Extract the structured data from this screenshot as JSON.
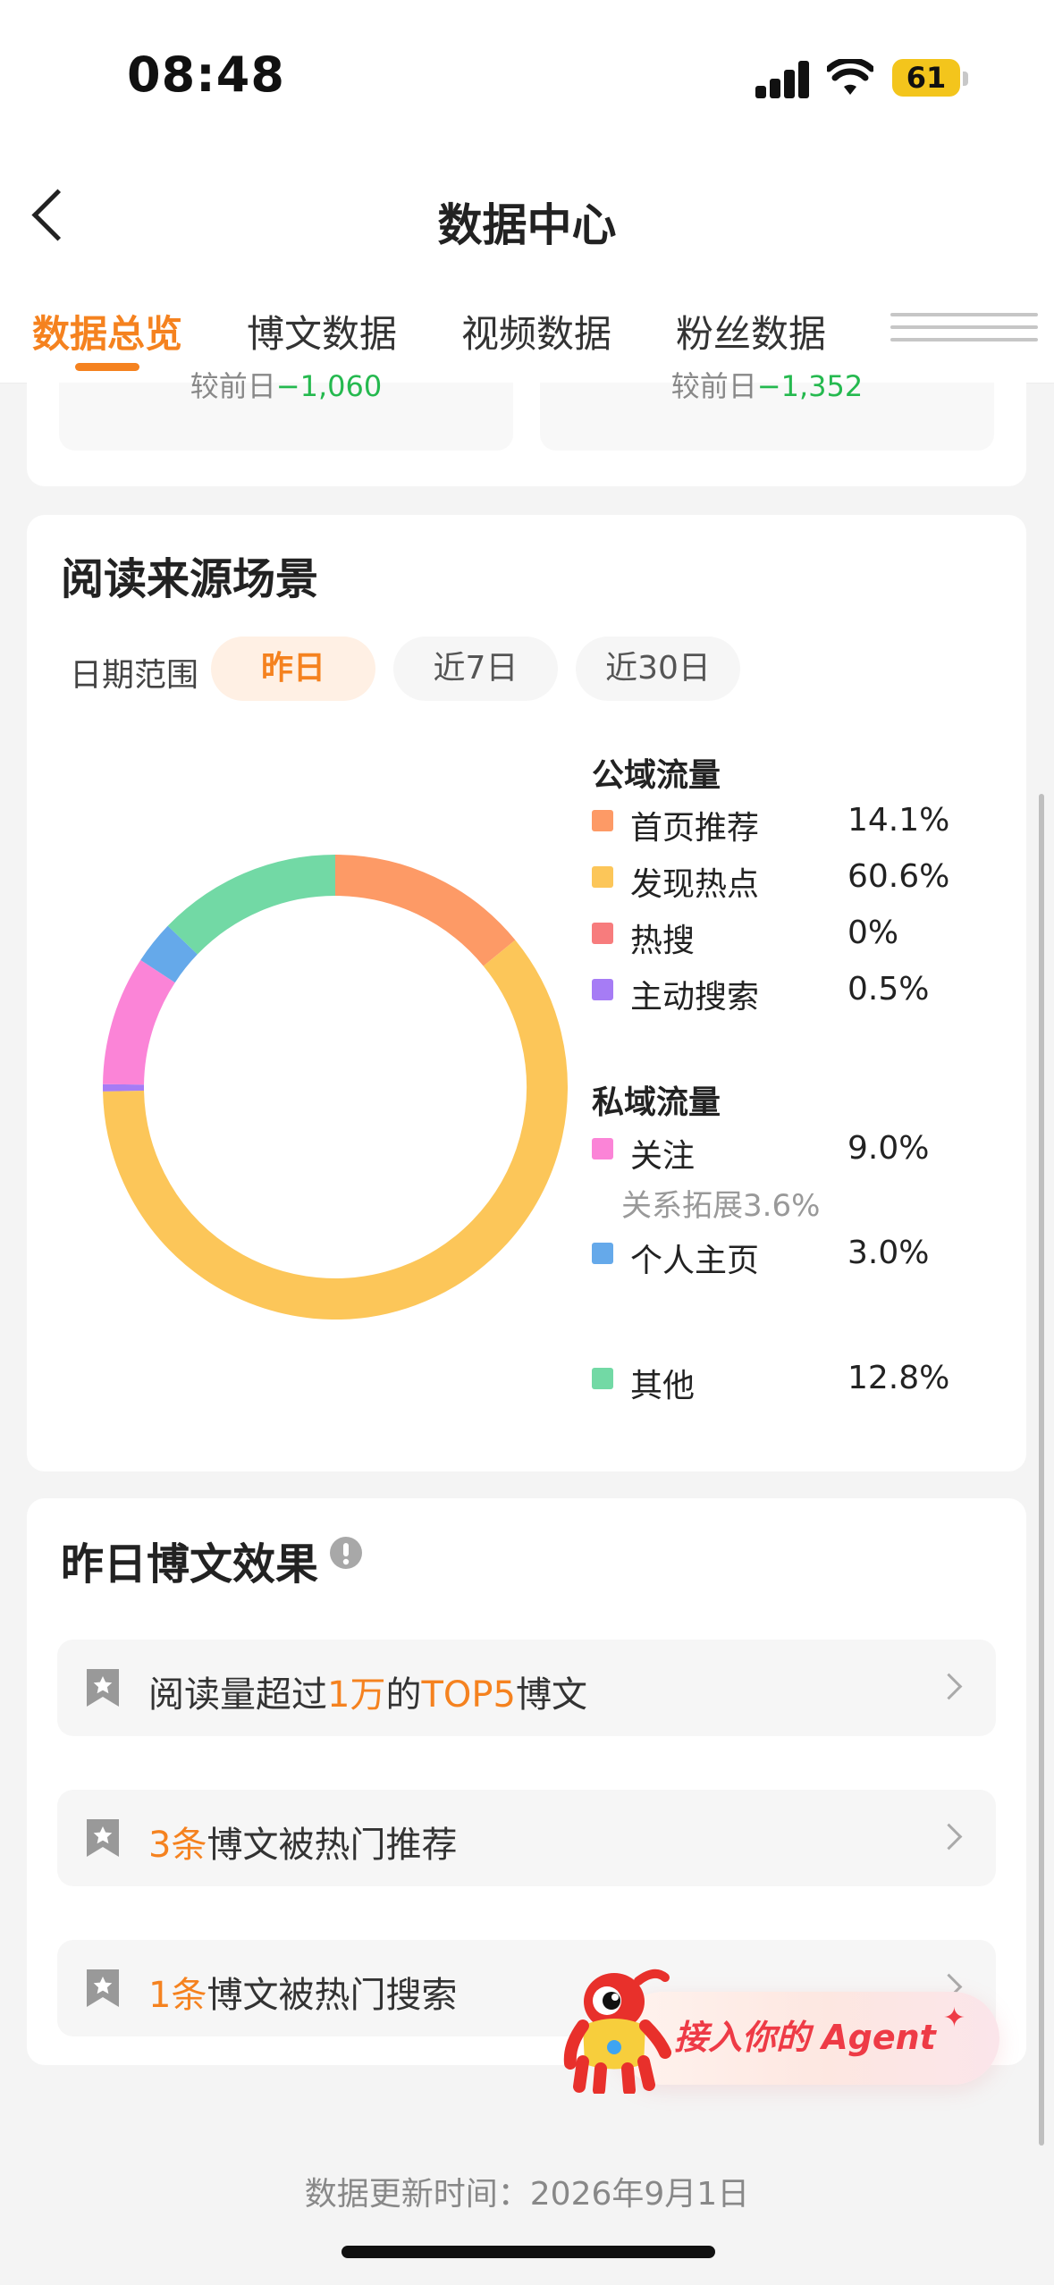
{
  "status_bar": {
    "time": "08:48",
    "battery": "61"
  },
  "header": {
    "title": "数据中心",
    "back_icon": "chevron-left-icon"
  },
  "tabs": [
    {
      "label": "数据总览",
      "active": true
    },
    {
      "label": "博文数据",
      "active": false
    },
    {
      "label": "视频数据",
      "active": false
    },
    {
      "label": "粉丝数据",
      "active": false
    }
  ],
  "top_compare": {
    "left": {
      "prefix": "较前日",
      "value": "−1,060"
    },
    "right": {
      "prefix": "较前日",
      "value": "−1,352"
    }
  },
  "reading_source": {
    "title": "阅读来源场景",
    "date_range_label": "日期范围",
    "ranges": [
      "昨日",
      "近7日",
      "近30日"
    ],
    "selected_range": "昨日",
    "public_title": "公域流量",
    "private_title": "私域流量",
    "legend": [
      {
        "label": "首页推荐",
        "value": "14.1%",
        "color": "#fd9a66"
      },
      {
        "label": "发现热点",
        "value": "60.6%",
        "color": "#fcc659"
      },
      {
        "label": "热搜",
        "value": "0%",
        "color": "#f77c7d"
      },
      {
        "label": "主动搜索",
        "value": "0.5%",
        "color": "#a67cf5"
      },
      {
        "label": "关注",
        "value": "9.0%",
        "color": "#fb84d7",
        "sub": "关系拓展3.6%"
      },
      {
        "label": "个人主页",
        "value": "3.0%",
        "color": "#65a9ea"
      },
      {
        "label": "其他",
        "value": "12.8%",
        "color": "#72d9a5"
      }
    ]
  },
  "chart_data": {
    "type": "pie",
    "categories": [
      "首页推荐",
      "发现热点",
      "热搜",
      "主动搜索",
      "关注",
      "个人主页",
      "其他"
    ],
    "values": [
      14.1,
      60.6,
      0,
      0.5,
      9.0,
      3.0,
      12.8
    ],
    "colors": [
      "#fd9a66",
      "#fcc659",
      "#f77c7d",
      "#a67cf5",
      "#fb84d7",
      "#65a9ea",
      "#72d9a5"
    ],
    "title": "",
    "legend_groups": [
      "公域流量",
      "私域流量"
    ]
  },
  "yesterday_effect": {
    "title": "昨日博文效果",
    "info_icon": "info-icon",
    "rows": [
      {
        "parts": [
          "阅读量超过",
          "1万",
          "的",
          "TOP5",
          "博文"
        ]
      },
      {
        "parts": [
          "3条",
          "博文被热门推荐"
        ]
      },
      {
        "parts": [
          "1条",
          "博文被热门搜索"
        ]
      }
    ]
  },
  "agent_button": {
    "label": "接入你的 Agent",
    "sparkle": "✦"
  },
  "footer": {
    "update_time": "数据更新时间：2026年9月1日"
  }
}
